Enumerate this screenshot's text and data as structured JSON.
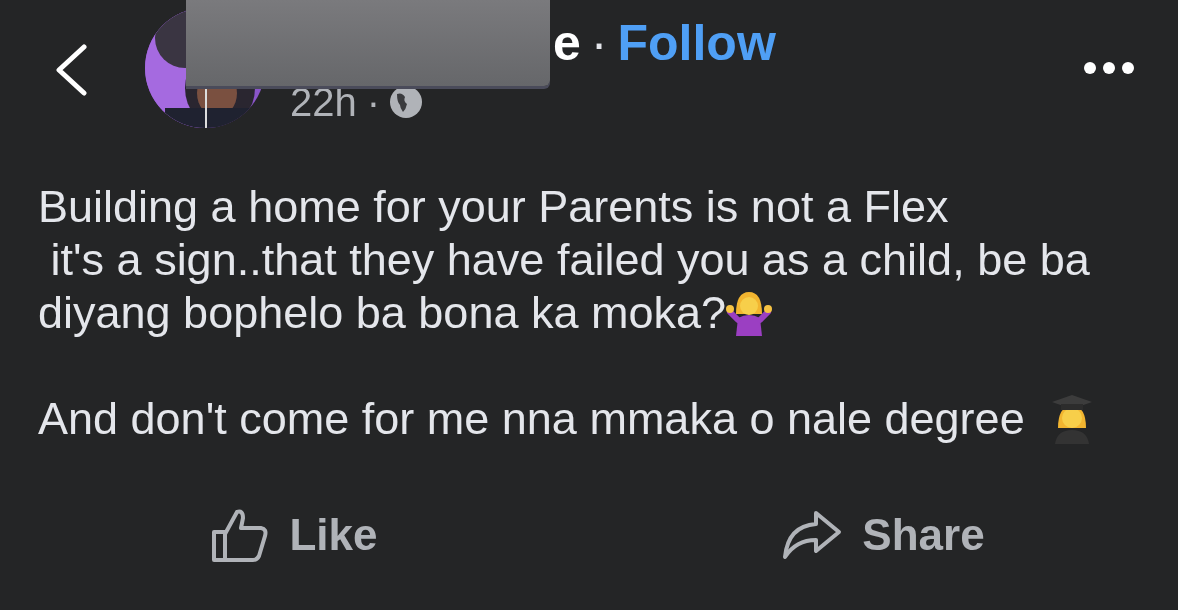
{
  "header": {
    "author_name": "e",
    "separator": "·",
    "follow": "Follow",
    "time": "22h",
    "time_separator": "·"
  },
  "post": {
    "paragraphs": [
      {
        "lines": [
          {
            "text": "Building a home for your Parents is not a Flex"
          },
          {
            "text": " it's a sign..that they have failed you as a child, be ba"
          },
          {
            "text": "diyang bophelo ba bona ka moka?",
            "kind": "shrug"
          }
        ]
      },
      {
        "lines": [
          {
            "text": "And don't come for me nna mmaka o nale degree ",
            "kind": "graduate"
          }
        ]
      }
    ]
  },
  "actions": [
    {
      "label": "Like",
      "kind": "like"
    },
    {
      "label": "Share",
      "kind": "share"
    }
  ]
}
